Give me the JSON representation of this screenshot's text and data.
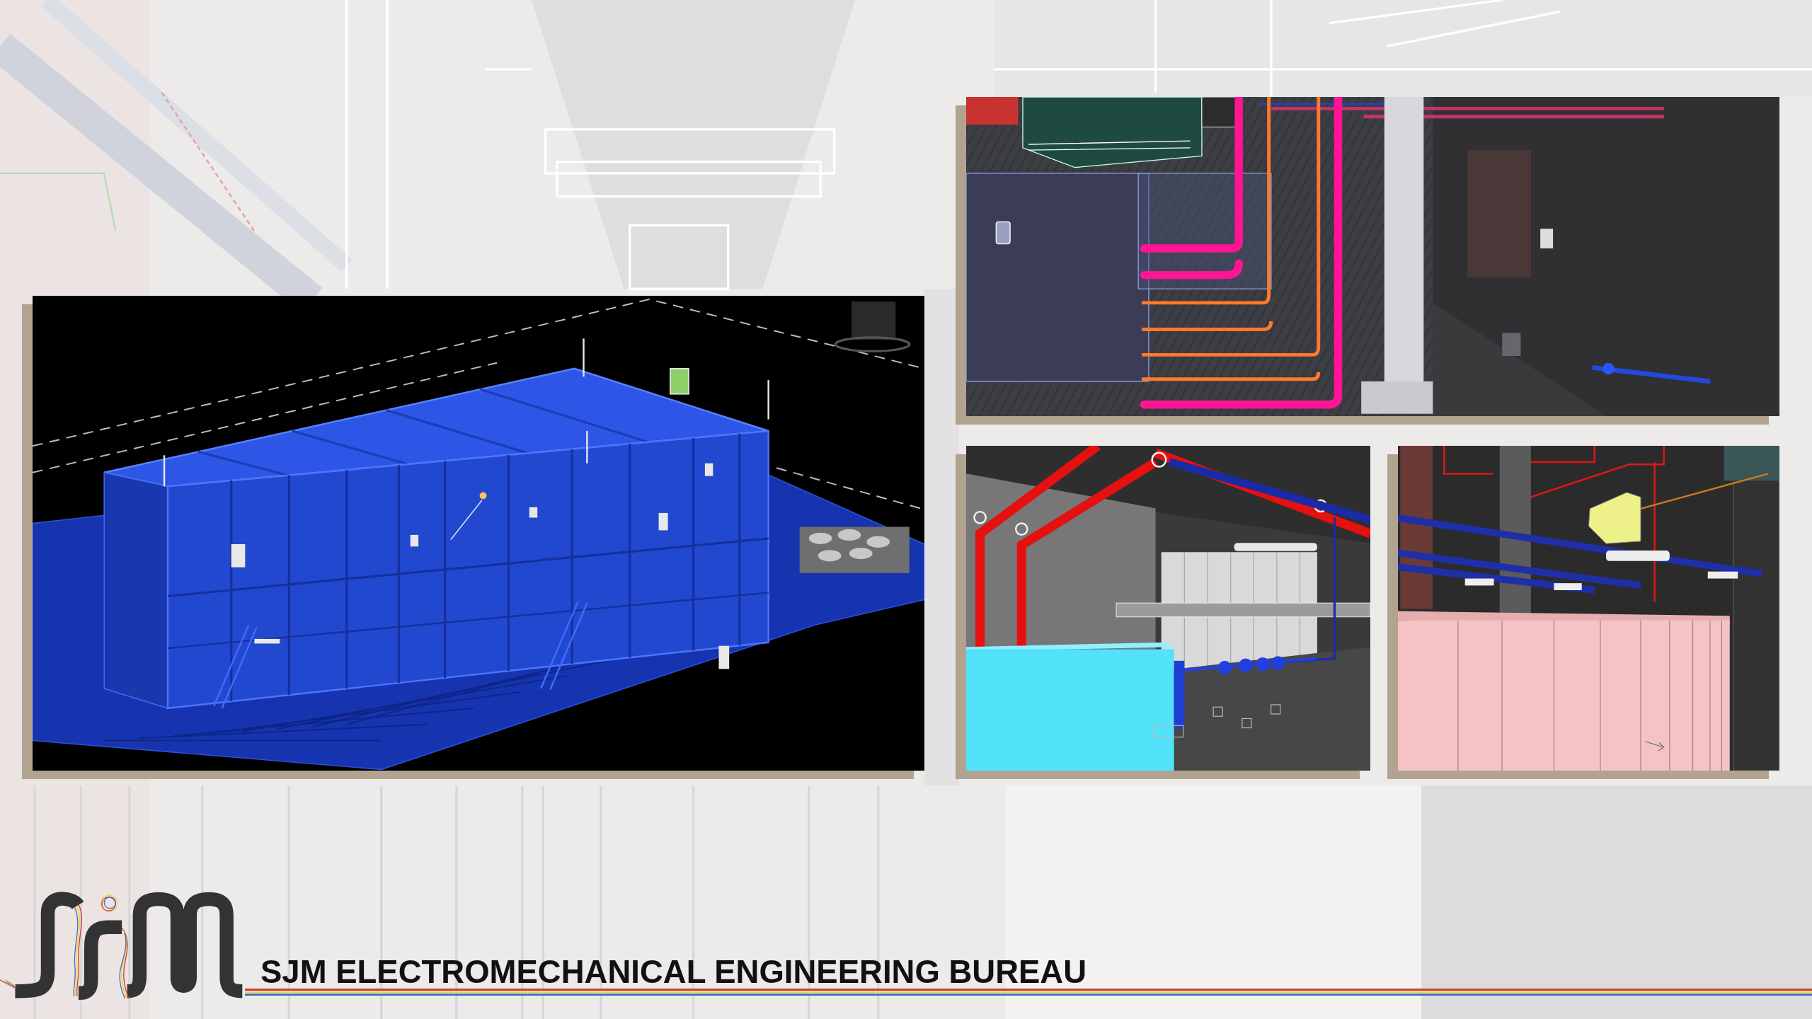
{
  "renders": [
    {
      "kind": "building"
    },
    {
      "kind": "pipe-corridor"
    },
    {
      "kind": "pump-room"
    },
    {
      "kind": "cabinet-room"
    }
  ],
  "footer": {
    "company_name": "SJM ELECTROMECHANICAL ENGINEERING BUREAU"
  }
}
